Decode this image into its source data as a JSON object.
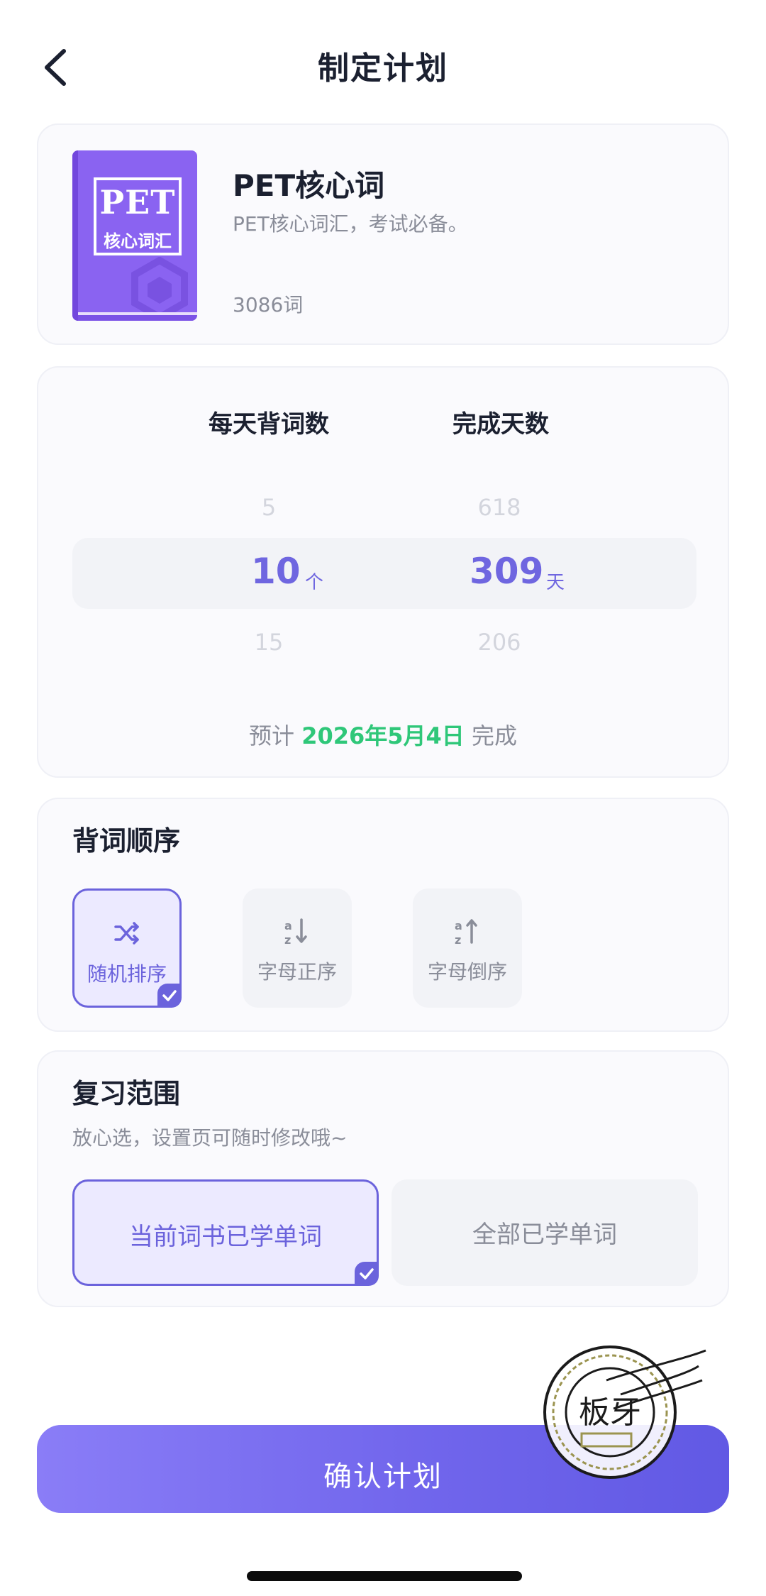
{
  "header": {
    "title": "制定计划",
    "back_icon": "chevron-left-icon"
  },
  "book": {
    "cover_line1": "PET",
    "cover_line2": "核心词汇",
    "cover_color": "#8a63f1",
    "title": "PET核心词",
    "description": "PET核心词汇，考试必备。",
    "word_count": "3086词"
  },
  "plan": {
    "daily_label": "每天背词数",
    "days_label": "完成天数",
    "daily_options": [
      "5",
      "10",
      "15"
    ],
    "daily_selected": "10",
    "daily_unit": "个",
    "days_options": [
      "618",
      "309",
      "206"
    ],
    "days_selected": "309",
    "days_unit": "天",
    "estimate_prefix": "预计",
    "estimate_date": "2026年5月4日",
    "estimate_suffix": "完成"
  },
  "order": {
    "title": "背词顺序",
    "options": [
      {
        "label": "随机排序",
        "icon": "shuffle-icon",
        "selected": true
      },
      {
        "label": "字母正序",
        "icon": "sort-az-icon",
        "selected": false
      },
      {
        "label": "字母倒序",
        "icon": "sort-za-icon",
        "selected": false
      }
    ]
  },
  "review": {
    "title": "复习范围",
    "subtitle": "放心选，设置页可随时修改哦~",
    "options": [
      {
        "label": "当前词书已学单词",
        "selected": true
      },
      {
        "label": "全部已学单词",
        "selected": false
      }
    ]
  },
  "stamp": {
    "text": "板牙"
  },
  "confirm": {
    "label": "确认计划"
  },
  "colors": {
    "accent": "#6b63dc",
    "green": "#2fc779",
    "muted": "#8a8d99"
  }
}
